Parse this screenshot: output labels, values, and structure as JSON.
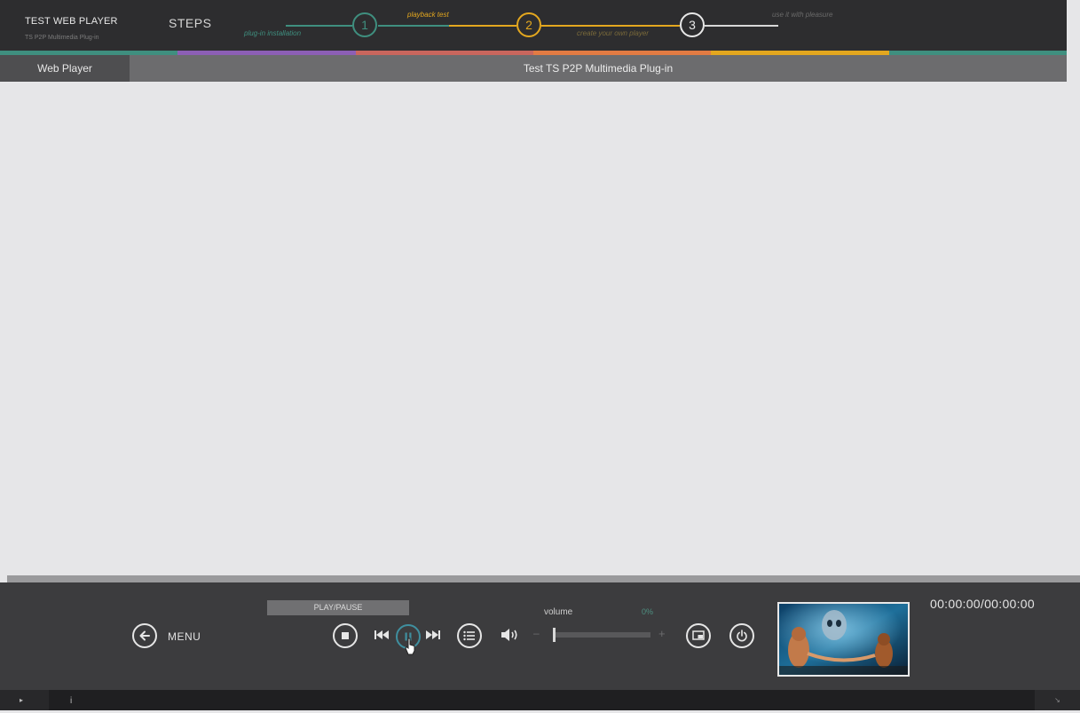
{
  "header": {
    "brand_title": "TEST WEB PLAYER",
    "brand_subtitle": "TS P2P Multimedia Plug-in",
    "steps_label": "STEPS",
    "steps": [
      {
        "number": "1",
        "caption": "plug-in installation",
        "color": "#3f8f7f"
      },
      {
        "number": "2",
        "caption": "playback test",
        "caption2": "create your own player",
        "color": "#e3a71f"
      },
      {
        "number": "3",
        "caption": "use it with pleasure",
        "color": "#e8e8e8"
      }
    ],
    "strip_colors": [
      "#3f8f7f",
      "#8c5fb5",
      "#c9665d",
      "#e27b43",
      "#e3a71f",
      "#3f8f7f"
    ]
  },
  "tabs": {
    "web_player": "Web Player",
    "title": "Test TS P2P Multimedia Plug-in"
  },
  "controls": {
    "menu_label": "MENU",
    "tooltip": "PLAY/PAUSE",
    "volume_label": "volume",
    "volume_value": "0%",
    "volume_minus": "–",
    "volume_plus": "+",
    "time": "00:00:00/00:00:00",
    "icons": {
      "back": "arrow-left-circle-icon",
      "stop": "stop-icon",
      "prev": "skip-previous-icon",
      "playpause": "play-pause-icon",
      "next": "skip-next-icon",
      "playlist": "playlist-icon",
      "speaker": "speaker-icon",
      "pip": "picture-in-picture-icon",
      "power": "power-icon"
    }
  },
  "status_bar": {
    "left_glyph": "▸",
    "info_glyph": "i",
    "right_glyph": "↘"
  }
}
